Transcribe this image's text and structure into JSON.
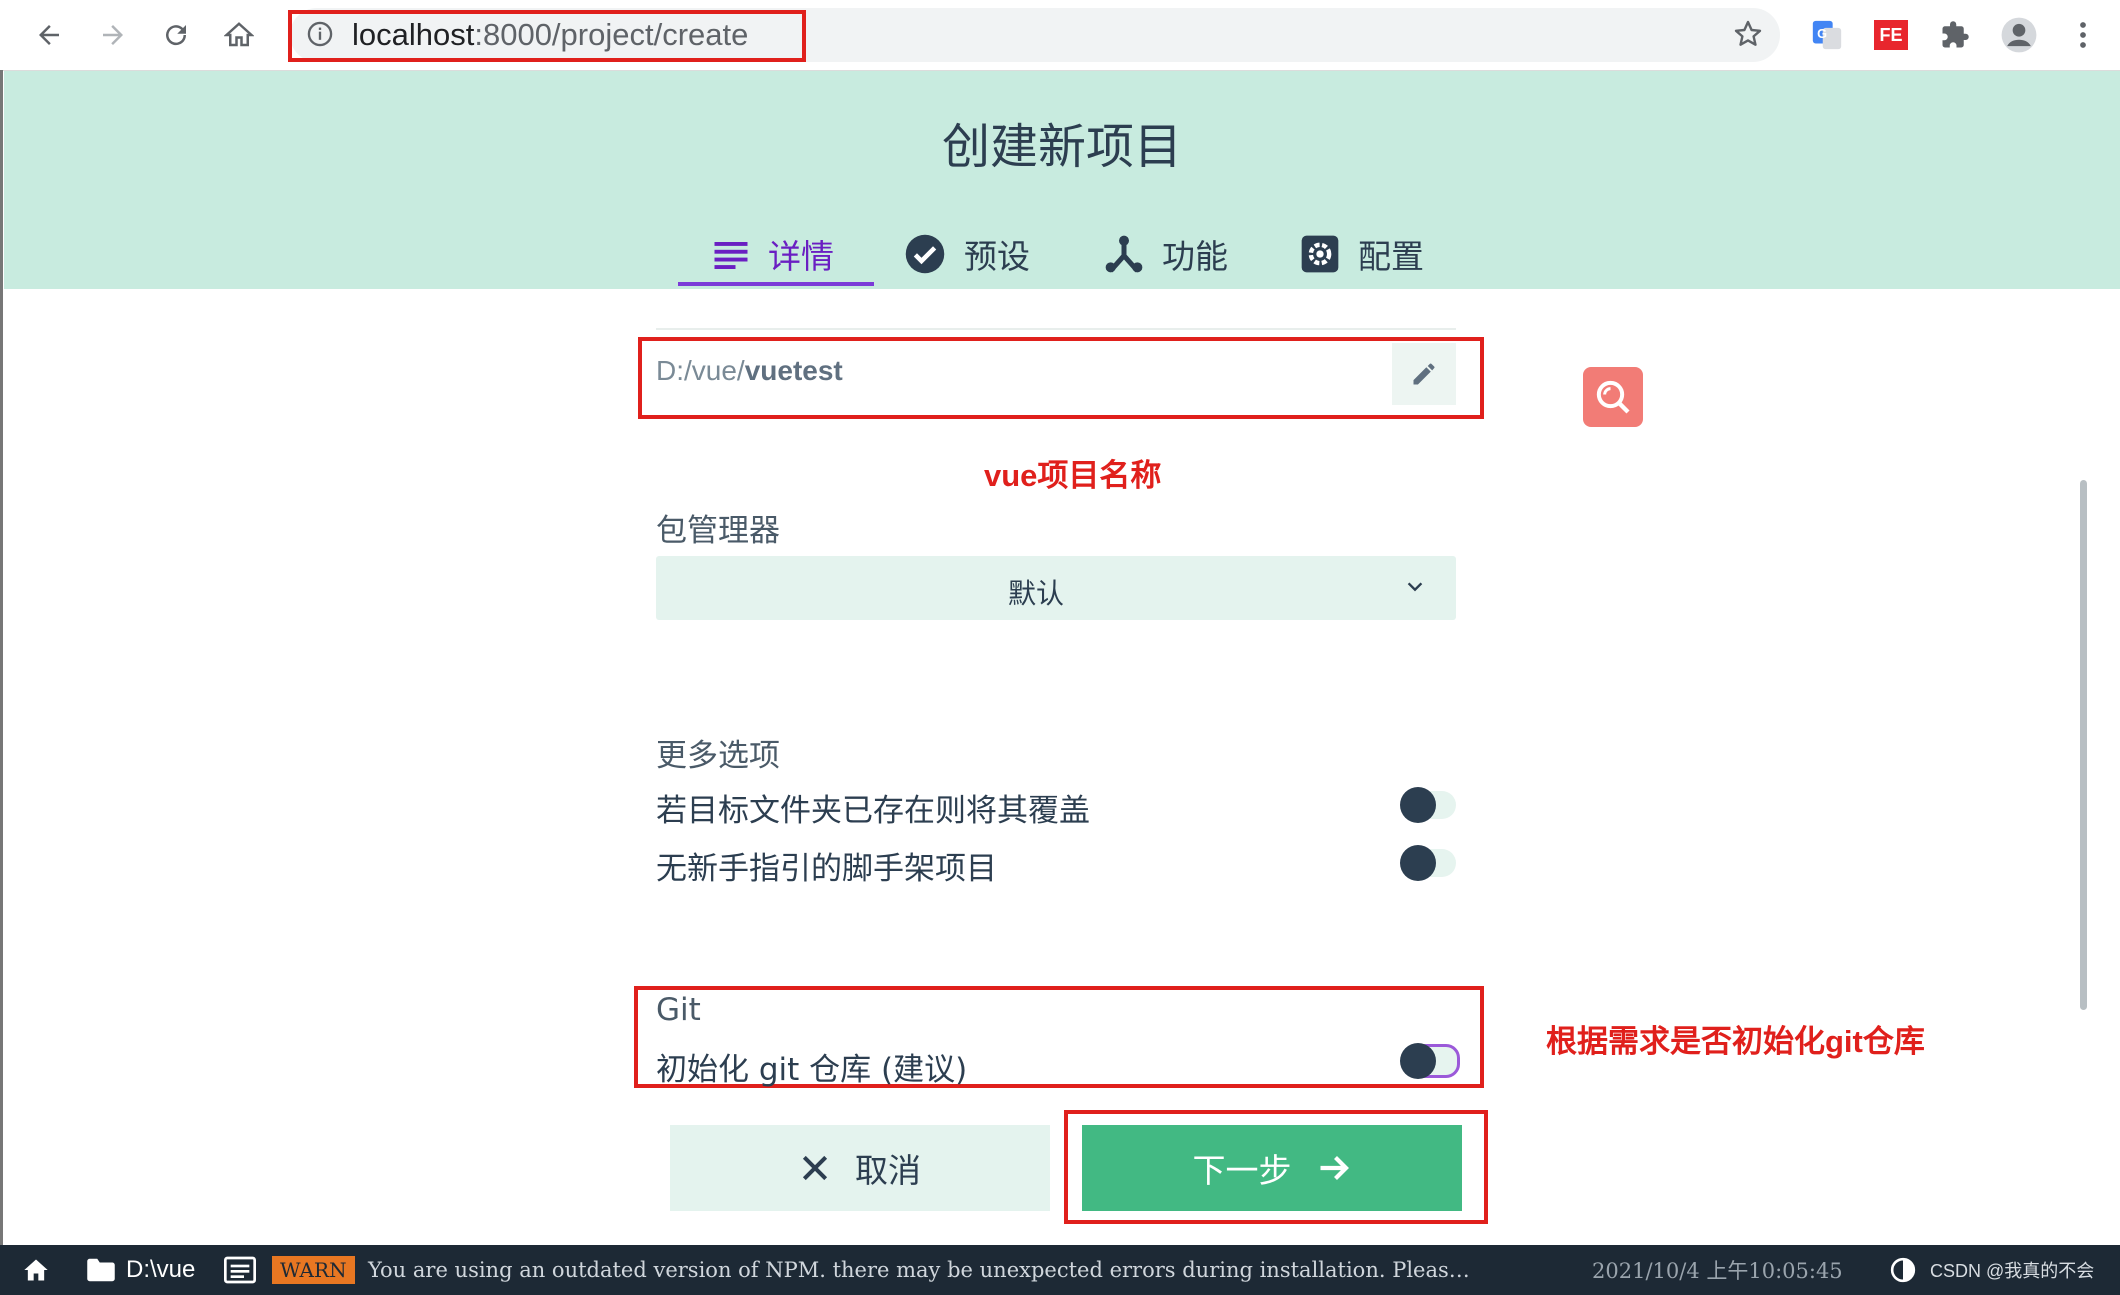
{
  "browser": {
    "url_host": "localhost",
    "url_rest": ":8000/project/create",
    "back_icon": "arrow-left-icon",
    "forward_icon": "arrow-right-icon",
    "reload_icon": "reload-icon",
    "home_icon": "home-icon",
    "info_icon": "info-icon",
    "star_icon": "star-icon",
    "extensions": [
      "google-translate-icon",
      "fe-extension-icon",
      "puzzle-icon",
      "profile-avatar-icon",
      "kebab-menu-icon"
    ],
    "fe_label": "FE"
  },
  "header": {
    "title": "创建新项目",
    "tabs": [
      {
        "label": "详情",
        "icon": "list-icon",
        "active": true
      },
      {
        "label": "预设",
        "icon": "check-circle-icon",
        "active": false
      },
      {
        "label": "功能",
        "icon": "fork-icon",
        "active": false
      },
      {
        "label": "配置",
        "icon": "gear-icon",
        "active": false
      }
    ]
  },
  "form": {
    "path_prefix": "D:/vue/",
    "path_name": "vuetest",
    "annotation_name": "vue项目名称",
    "package_manager_label": "包管理器",
    "package_manager_value": "默认",
    "more_options_label": "更多选项",
    "options": [
      {
        "label": "若目标文件夹已存在则将其覆盖",
        "enabled": false
      },
      {
        "label": "无新手指引的脚手架项目",
        "enabled": false
      }
    ],
    "git_label": "Git",
    "git_option": "初始化 git 仓库 (建议)",
    "git_enabled": false,
    "annotation_git": "根据需求是否初始化git仓库",
    "cancel_label": "取消",
    "next_label": "下一步"
  },
  "statusbar": {
    "folder": "D:\\vue",
    "warn_badge": "WARN",
    "message": "You are using an outdated version of NPM. there may be unexpected errors during installation. Pleas…",
    "timestamp": "2021/10/4 上午10:05:45",
    "watermark": "CSDN @我真的不会"
  },
  "colors": {
    "header_bg": "#c8ebdf",
    "active_tab": "#6a1fc2",
    "primary_green": "#42b983",
    "annotation_red": "#e0201c",
    "statusbar_bg": "#1d2935"
  }
}
